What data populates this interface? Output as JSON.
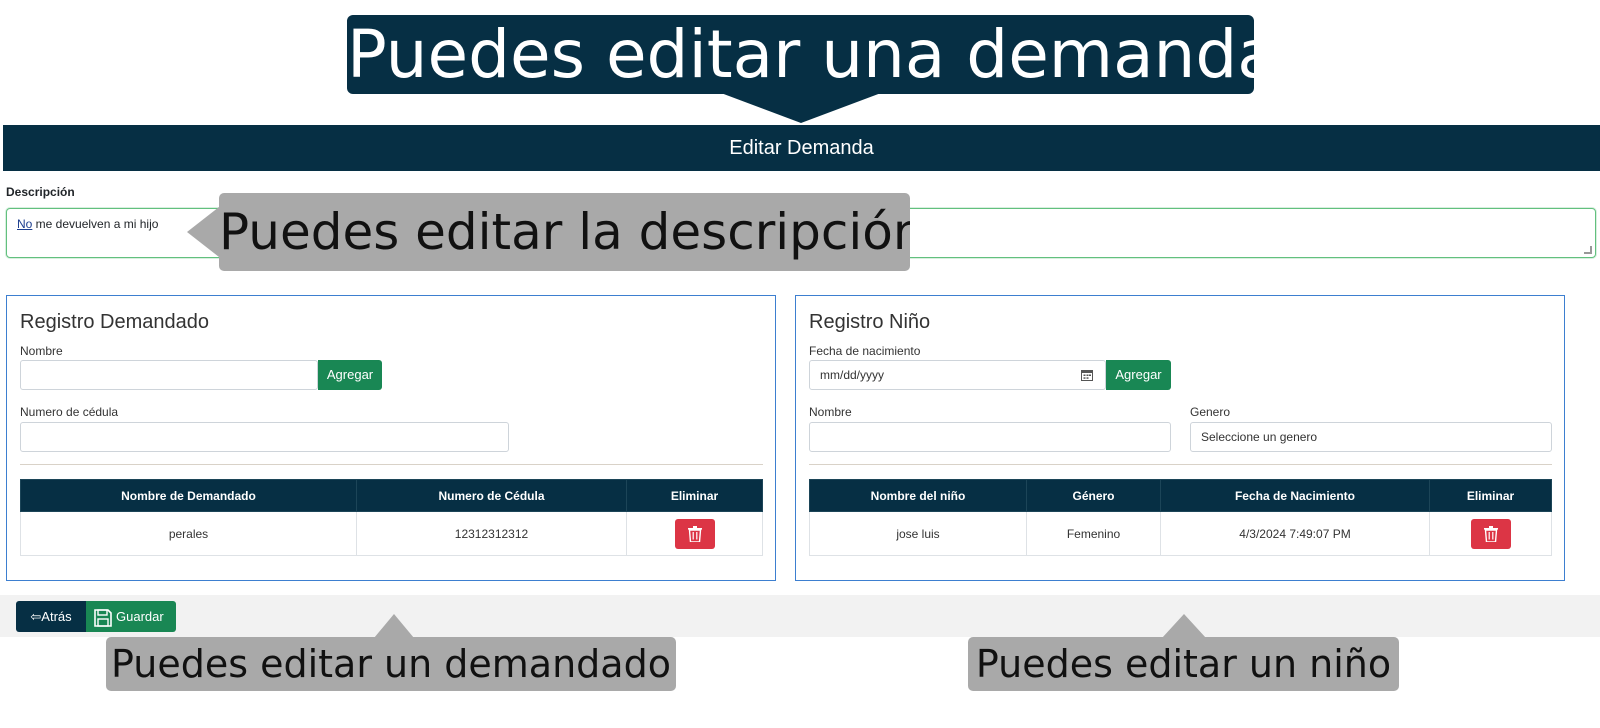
{
  "callouts": {
    "top": "Puedes editar una demanda",
    "description": "Puedes editar la descripción",
    "demandado": "Puedes editar un demandado",
    "nino": "Puedes editar un niño"
  },
  "header": {
    "title": "Editar Demanda"
  },
  "description": {
    "label": "Descripción",
    "value_first_word": "No",
    "value_rest": " me devuelven a mi hijo"
  },
  "demandado_panel": {
    "title": "Registro Demandado",
    "nombre_label": "Nombre",
    "nombre_value": "",
    "add_button": "Agregar",
    "cedula_label": "Numero de cédula",
    "cedula_value": "",
    "table": {
      "headers": [
        "Nombre de Demandado",
        "Numero de Cédula",
        "Eliminar"
      ],
      "rows": [
        {
          "nombre": "perales",
          "cedula": "12312312312"
        }
      ]
    }
  },
  "nino_panel": {
    "title": "Registro Niño",
    "fecha_label": "Fecha de nacimiento",
    "fecha_placeholder": "mm/dd/yyyy",
    "add_button": "Agregar",
    "nombre_label": "Nombre",
    "nombre_value": "",
    "genero_label": "Genero",
    "genero_selected": "Seleccione un genero",
    "table": {
      "headers": [
        "Nombre del niño",
        "Género",
        "Fecha de Nacimiento",
        "Eliminar"
      ],
      "rows": [
        {
          "nombre": "jose luis",
          "genero": "Femenino",
          "fecha": "4/3/2024 7:49:07 PM"
        }
      ]
    }
  },
  "footer": {
    "back_label": "Atrás",
    "save_label": "Guardar"
  },
  "colors": {
    "navy": "#062f44",
    "green": "#198754",
    "danger": "#dc3545",
    "callout_gray": "#a9a9a9"
  },
  "icons": [
    "arrow-left-icon",
    "save-icon",
    "trash-icon",
    "calendar-icon"
  ]
}
